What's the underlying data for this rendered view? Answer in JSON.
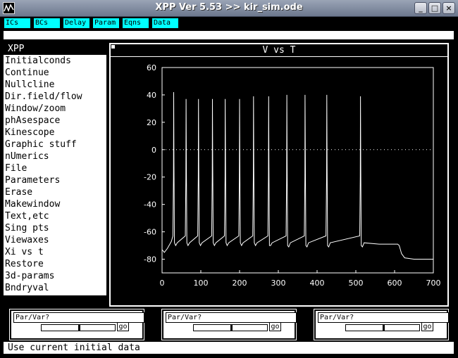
{
  "window": {
    "title": "XPP Ver 5.53 >> kir_sim.ode"
  },
  "titlebar_buttons": {
    "minimize": "_",
    "maximize": "□",
    "close": "×"
  },
  "topbar": {
    "buttons": [
      "ICs",
      "BCs",
      "Delay",
      "Param",
      "Eqns",
      "Data"
    ]
  },
  "menu": {
    "title": "XPP",
    "items": [
      "Initialconds",
      "Continue",
      "Nullcline",
      "Dir.field/flow",
      "Window/zoom",
      "phAsespace",
      "Kinescope",
      "Graphic stuff",
      "nUmerics",
      "File",
      "Parameters",
      "Erase",
      "Makewindow",
      "Text,etc",
      "Sing pts",
      "Viewaxes",
      "Xi vs t",
      "Restore",
      "3d-params",
      "Bndryval"
    ]
  },
  "graph": {
    "title": "V vs T"
  },
  "sliders": [
    {
      "label": "Par/Var?",
      "go": "go",
      "thumb": 0.5
    },
    {
      "label": "Par/Var?",
      "go": "go",
      "thumb": 0.5
    },
    {
      "label": "Par/Var?",
      "go": "go",
      "thumb": 0.5
    }
  ],
  "status": "Use current initial data",
  "colors": {
    "topbar_button": "#00ffff",
    "plot_bg": "#000000",
    "trace": "#ffffff",
    "menu_bg": "#ffffff"
  },
  "chart_data": {
    "type": "line",
    "title": "V vs T",
    "xlabel": "",
    "ylabel": "",
    "xlim": [
      0,
      700
    ],
    "ylim": [
      -90,
      60
    ],
    "xticks": [
      "0",
      "100",
      "200",
      "300",
      "400",
      "500",
      "600",
      "700"
    ],
    "yticks": [
      "60",
      "40",
      "20",
      "0",
      "-20",
      "-40",
      "-60",
      "-80"
    ],
    "zero_line": "dotted",
    "series": [
      {
        "spikes": [
          {
            "t": 30,
            "peak": 42
          },
          {
            "t": 62,
            "peak": 37
          },
          {
            "t": 94,
            "peak": 37
          },
          {
            "t": 130,
            "peak": 37
          },
          {
            "t": 163,
            "peak": 37
          },
          {
            "t": 200,
            "peak": 37
          },
          {
            "t": 236,
            "peak": 39
          },
          {
            "t": 275,
            "peak": 39
          },
          {
            "t": 322,
            "peak": 40
          },
          {
            "t": 369,
            "peak": 40
          },
          {
            "t": 425,
            "peak": 40
          },
          {
            "t": 512,
            "peak": 39
          }
        ],
        "x": [
          0,
          8,
          18,
          26,
          30,
          34,
          40,
          62,
          66,
          72,
          94,
          98,
          104,
          130,
          134,
          140,
          163,
          167,
          173,
          200,
          204,
          210,
          236,
          240,
          246,
          275,
          279,
          285,
          322,
          326,
          332,
          369,
          373,
          380,
          425,
          429,
          436,
          500,
          512,
          516,
          524,
          600,
          608,
          612,
          620,
          630,
          650,
          700
        ],
        "y": [
          -73,
          -75,
          -71,
          -66,
          42,
          -70,
          -68,
          37,
          -69,
          -67,
          37,
          -69,
          -67,
          37,
          -69,
          -67,
          37,
          -69,
          -67,
          37,
          -69,
          -67,
          39,
          -69,
          -67,
          39,
          -70,
          -67,
          40,
          -70,
          -67,
          40,
          -71,
          -68,
          40,
          -71,
          -68,
          -63,
          39,
          -69,
          -69,
          -69,
          -68,
          -70,
          -78,
          -79,
          -80,
          -80
        ]
      }
    ]
  }
}
